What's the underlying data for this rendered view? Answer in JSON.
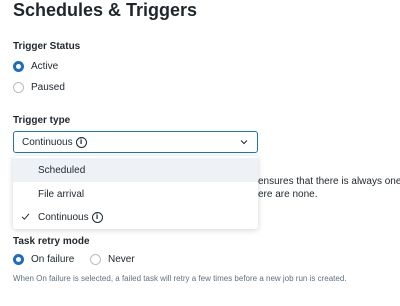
{
  "page": {
    "title": "Schedules & Triggers"
  },
  "trigger_status": {
    "label": "Trigger Status",
    "options": [
      {
        "label": "Active",
        "selected": true
      },
      {
        "label": "Paused",
        "selected": false
      }
    ]
  },
  "trigger_type": {
    "label": "Trigger type",
    "selected_value": "Continuous",
    "options": [
      {
        "label": "Scheduled",
        "highlighted": true
      },
      {
        "label": "File arrival",
        "highlighted": false
      },
      {
        "label": "Continuous",
        "selected": true
      }
    ],
    "partial_description_line1": "ensures that there is always one a",
    "partial_description_line2": "ere are none."
  },
  "task_retry": {
    "label": "Task retry mode",
    "options": [
      {
        "label": "On failure",
        "selected": true
      },
      {
        "label": "Never",
        "selected": false
      }
    ],
    "help_text": "When On failure is selected, a failed task will retry a few times before a new job run is created."
  },
  "colors": {
    "accent": "#2272b4",
    "radio_checked": "#1f6cc0",
    "muted_text": "#5f7281"
  },
  "icons": {
    "info": "info-icon",
    "chevron": "chevron-down-icon",
    "check": "check-icon"
  }
}
